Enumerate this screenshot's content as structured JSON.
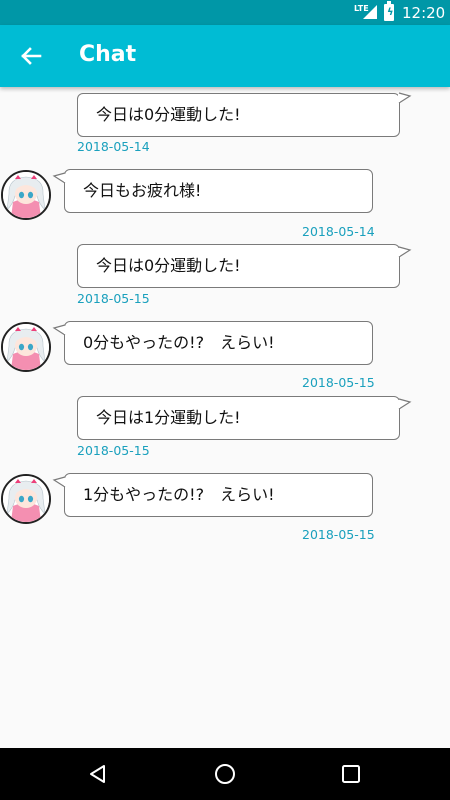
{
  "status_bar": {
    "network": "LTE",
    "time": "12:20"
  },
  "app_bar": {
    "title": "Chat"
  },
  "messages": [
    {
      "sender": "me",
      "text": "今日は0分運動した!",
      "date": "2018-05-14"
    },
    {
      "sender": "other",
      "text": "今日もお疲れ様!",
      "date": "2018-05-14"
    },
    {
      "sender": "me",
      "text": "今日は0分運動した!",
      "date": "2018-05-15"
    },
    {
      "sender": "other",
      "text": "0分もやったの!?　えらい!",
      "date": "2018-05-15"
    },
    {
      "sender": "me",
      "text": "今日は1分運動した!",
      "date": "2018-05-15"
    },
    {
      "sender": "other",
      "text": "1分もやったの!?　えらい!",
      "date": "2018-05-15"
    }
  ],
  "icons": {
    "back": "arrow-back-icon",
    "nav_back": "triangle-back-icon",
    "nav_home": "circle-home-icon",
    "nav_recents": "square-recents-icon"
  },
  "colors": {
    "status_bar": "#0097a7",
    "app_bar": "#00bcd4",
    "date_text": "#1aa0bd",
    "background": "#fafafa"
  }
}
